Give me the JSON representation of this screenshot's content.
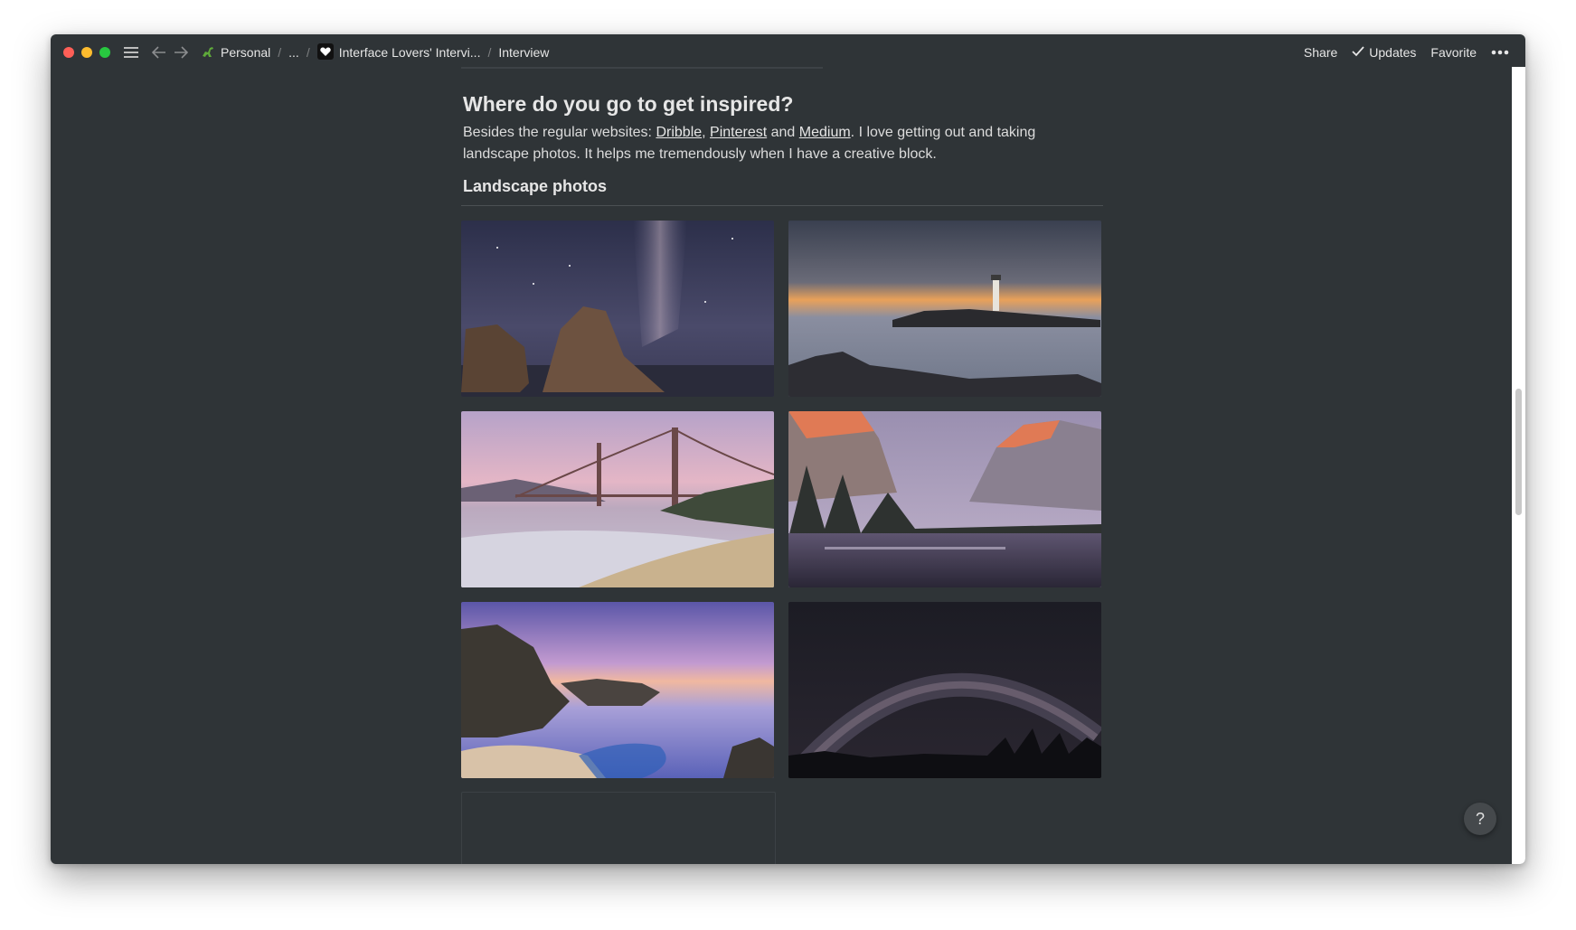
{
  "titlebar": {
    "breadcrumbs": [
      {
        "label": "Personal",
        "icon": "dinosaur-icon"
      },
      {
        "label": "..."
      },
      {
        "label": "Interface Lovers' Intervi...",
        "icon": "heart-icon"
      },
      {
        "label": "Interview"
      }
    ],
    "actions": {
      "share": "Share",
      "updates": "Updates",
      "favorite": "Favorite"
    }
  },
  "page": {
    "heading": "Where do you go to get inspired?",
    "para_prefix": "Besides the regular websites: ",
    "link1": "Dribble",
    "comma": ", ",
    "link2": "Pinterest",
    "and": " and ",
    "link3": "Medium",
    "para_suffix": ". I love getting out and taking landscape photos. It helps me tremendously when I have a creative block.",
    "subheading": "Landscape photos"
  },
  "gallery": {
    "photos": [
      {
        "subject": "milky-way-sea-stacks"
      },
      {
        "subject": "lighthouse-sunset"
      },
      {
        "subject": "golden-gate-bridge-beach"
      },
      {
        "subject": "yosemite-valley-reflection"
      },
      {
        "subject": "big-sur-waterfall-cove"
      },
      {
        "subject": "milky-way-arch-night"
      }
    ]
  },
  "help": {
    "label": "?"
  },
  "colors": {
    "window_bg": "#2f3437",
    "text": "#e6e6e6"
  }
}
